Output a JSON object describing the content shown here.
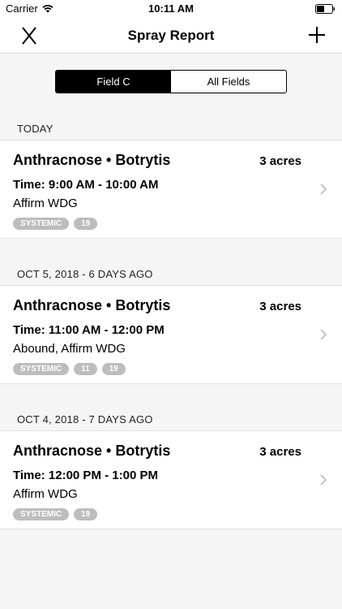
{
  "status_bar": {
    "carrier": "Carrier",
    "time": "10:11 AM"
  },
  "nav": {
    "title": "Spray Report",
    "close_icon": "close-x-icon",
    "add_icon": "plus-icon"
  },
  "segments": [
    {
      "label": "Field C",
      "active": true
    },
    {
      "label": "All Fields",
      "active": false
    }
  ],
  "sections": [
    {
      "header": "TODAY",
      "card": {
        "title": "Anthracnose • Botrytis",
        "area": "3 acres",
        "time": "Time: 9:00 AM - 10:00 AM",
        "products": "Affirm WDG",
        "tags": [
          "SYSTEMIC",
          "19"
        ]
      }
    },
    {
      "header": "OCT 5, 2018 - 6 DAYS AGO",
      "card": {
        "title": "Anthracnose • Botrytis",
        "area": "3 acres",
        "time": "Time: 11:00 AM - 12:00 PM",
        "products": "Abound, Affirm WDG",
        "tags": [
          "SYSTEMIC",
          "11",
          "19"
        ]
      }
    },
    {
      "header": "OCT 4, 2018 - 7 DAYS AGO",
      "card": {
        "title": "Anthracnose • Botrytis",
        "area": "3 acres",
        "time": "Time: 12:00 PM - 1:00 PM",
        "products": "Affirm WDG",
        "tags": [
          "SYSTEMIC",
          "19"
        ]
      }
    }
  ],
  "colors": {
    "tag_bg": "#bdbdbd",
    "segment_active": "#000000",
    "background": "#f5f5f5"
  }
}
